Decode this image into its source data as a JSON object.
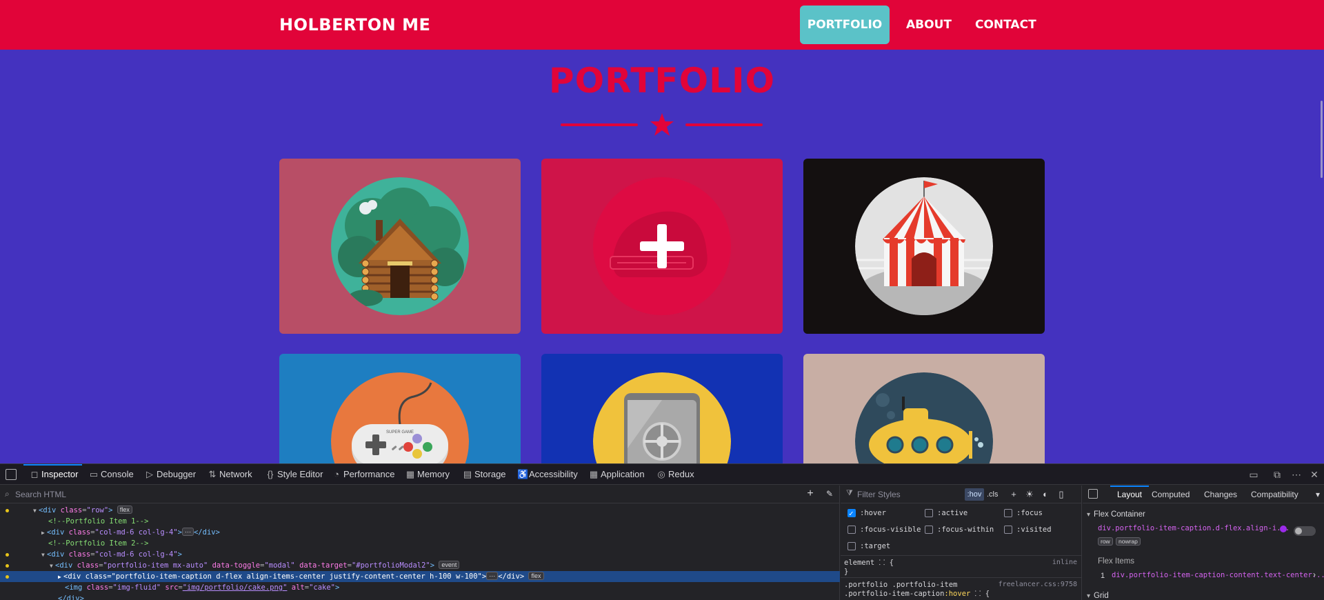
{
  "site": {
    "brand": "HOLBERTON ME",
    "nav": [
      "PORTFOLIO",
      "ABOUT",
      "CONTACT"
    ],
    "heading": "PORTFOLIO",
    "colors": {
      "navbar": "#e10439",
      "page_bg": "#4432bf",
      "nav_active": "#5bc2c8",
      "accent": "#e10439"
    },
    "portfolio_items": [
      {
        "image": "cabin",
        "bg": "#b84e66"
      },
      {
        "image": "cake (hover overlay with plus-icon)",
        "bg": "#cf1449"
      },
      {
        "image": "circus-tent",
        "bg": "#141010"
      },
      {
        "image": "game-controller",
        "bg": "#1e7ec1"
      },
      {
        "image": "safe",
        "bg": "#1232b3"
      },
      {
        "image": "submarine",
        "bg": "#c8aea4"
      }
    ],
    "game_controller_text": "SUPER GAME"
  },
  "devtools": {
    "tabs": [
      "Inspector",
      "Console",
      "Debugger",
      "Network",
      "Style Editor",
      "Performance",
      "Memory",
      "Storage",
      "Accessibility",
      "Application",
      "Redux"
    ],
    "tab_icons": [
      "inspector-icon",
      "console-icon",
      "debugger-icon",
      "network-icon",
      "style-editor-icon",
      "performance-icon",
      "memory-icon",
      "storage-icon",
      "accessibility-icon",
      "application-icon",
      "redux-icon"
    ],
    "active_tab": "Inspector",
    "search_placeholder": "Search HTML",
    "html_tree": {
      "l1_tag": "<div ",
      "l1_attr": "class",
      "l1_val": "\"row\"",
      "l1_end": ">",
      "l1_badge": "flex",
      "l2_comment": "<!--Portfolio Item 1-->",
      "l3_tag": "<div ",
      "l3_attr": "class",
      "l3_val": "\"col-md-6 col-lg-4\"",
      "l3_end": ">",
      "l3_close": "</div>",
      "l4_comment": "<!--Portfolio Item 2-->",
      "l5_tag": "<div ",
      "l5_attr": "class",
      "l5_val": "\"col-md-6 col-lg-4\"",
      "l5_end": ">",
      "l6_tag": "<div ",
      "l6_attr1": "class",
      "l6_val1": "\"portfolio-item mx-auto\"",
      "l6_attr2": "data-toggle",
      "l6_val2": "\"modal\"",
      "l6_attr3": "data-target",
      "l6_val3": "\"#portfolioModal2\"",
      "l6_end": ">",
      "l6_badge": "event",
      "l7_tag": "<div ",
      "l7_attr": "class",
      "l7_val": "\"portfolio-item-caption d-flex align-items-center justify-content-center h-100 w-100\"",
      "l7_end": ">",
      "l7_close": "</div>",
      "l7_badge": "flex",
      "l8_tag": "<img ",
      "l8_attr1": "class",
      "l8_val1": "\"img-fluid\"",
      "l8_attr2": "src",
      "l8_val2": "\"img/portfolio/cake.png\"",
      "l8_attr3": "alt",
      "l8_val3": "\"cake\"",
      "l8_end": ">",
      "l9_close": "</div>",
      "ellipsis": "⋯"
    },
    "rules": {
      "filter_placeholder": "Filter Styles",
      "hov": ":hov",
      "cls": ".cls",
      "pseudo": [
        ":hover",
        ":active",
        ":focus",
        ":focus-visible",
        ":focus-within",
        ":visited",
        ":target"
      ],
      "pseudo_checked": [
        ":hover"
      ],
      "element_line": "element",
      "element_brace_open": "{",
      "element_source": "inline",
      "element_close": "}",
      "rule_selector_1": ".portfolio .portfolio-item",
      "rule_selector_2_prefix": ".portfolio-item-caption",
      "rule_selector_2_pseudo": ":hover",
      "rule_selector_2_suffix": " {",
      "rule_source": "freelancer.css:9758"
    },
    "layout": {
      "tabs": [
        "Layout",
        "Computed",
        "Changes",
        "Compatibility"
      ],
      "active_tab": "Layout",
      "flex_container_title": "Flex Container",
      "flex_container_selector": "div.portfolio-item-caption.d-flex.align-i...",
      "chips": [
        "row",
        "nowrap"
      ],
      "flex_items_title": "Flex Items",
      "flex_item_number": "1",
      "flex_item_selector": "div.portfolio-item-caption-content.text-center...",
      "grid_title": "Grid"
    }
  }
}
